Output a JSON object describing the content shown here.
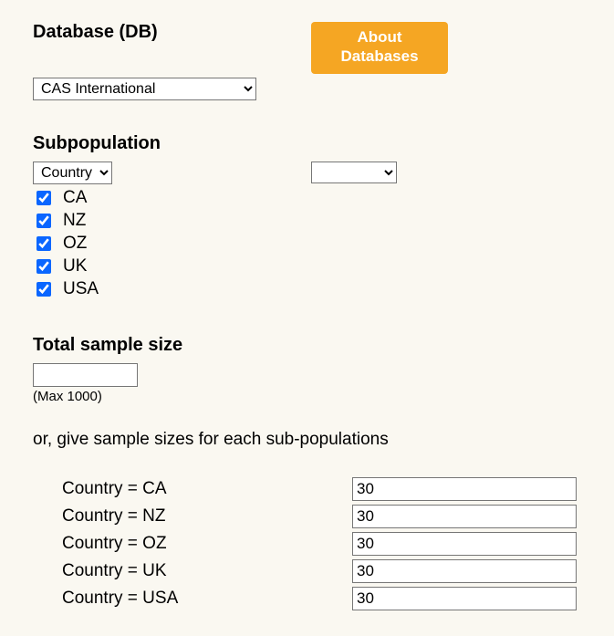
{
  "database": {
    "heading": "Database (DB)",
    "about_button_line1": "About",
    "about_button_line2": "Databases",
    "selected": "CAS International"
  },
  "subpopulation": {
    "heading": "Subpopulation",
    "selected": "Country",
    "second_select": "",
    "items": [
      {
        "code": "CA",
        "checked": true
      },
      {
        "code": "NZ",
        "checked": true
      },
      {
        "code": "OZ",
        "checked": true
      },
      {
        "code": "UK",
        "checked": true
      },
      {
        "code": "USA",
        "checked": true
      }
    ]
  },
  "total_sample_size": {
    "heading": "Total sample size",
    "value": "",
    "hint": "(Max 1000)"
  },
  "or_text": "or, give sample sizes for each sub-populations",
  "per_subpop": [
    {
      "label": "Country = CA",
      "value": "30"
    },
    {
      "label": "Country = NZ",
      "value": "30"
    },
    {
      "label": "Country = OZ",
      "value": "30"
    },
    {
      "label": "Country = UK",
      "value": "30"
    },
    {
      "label": "Country = USA",
      "value": "30"
    }
  ]
}
